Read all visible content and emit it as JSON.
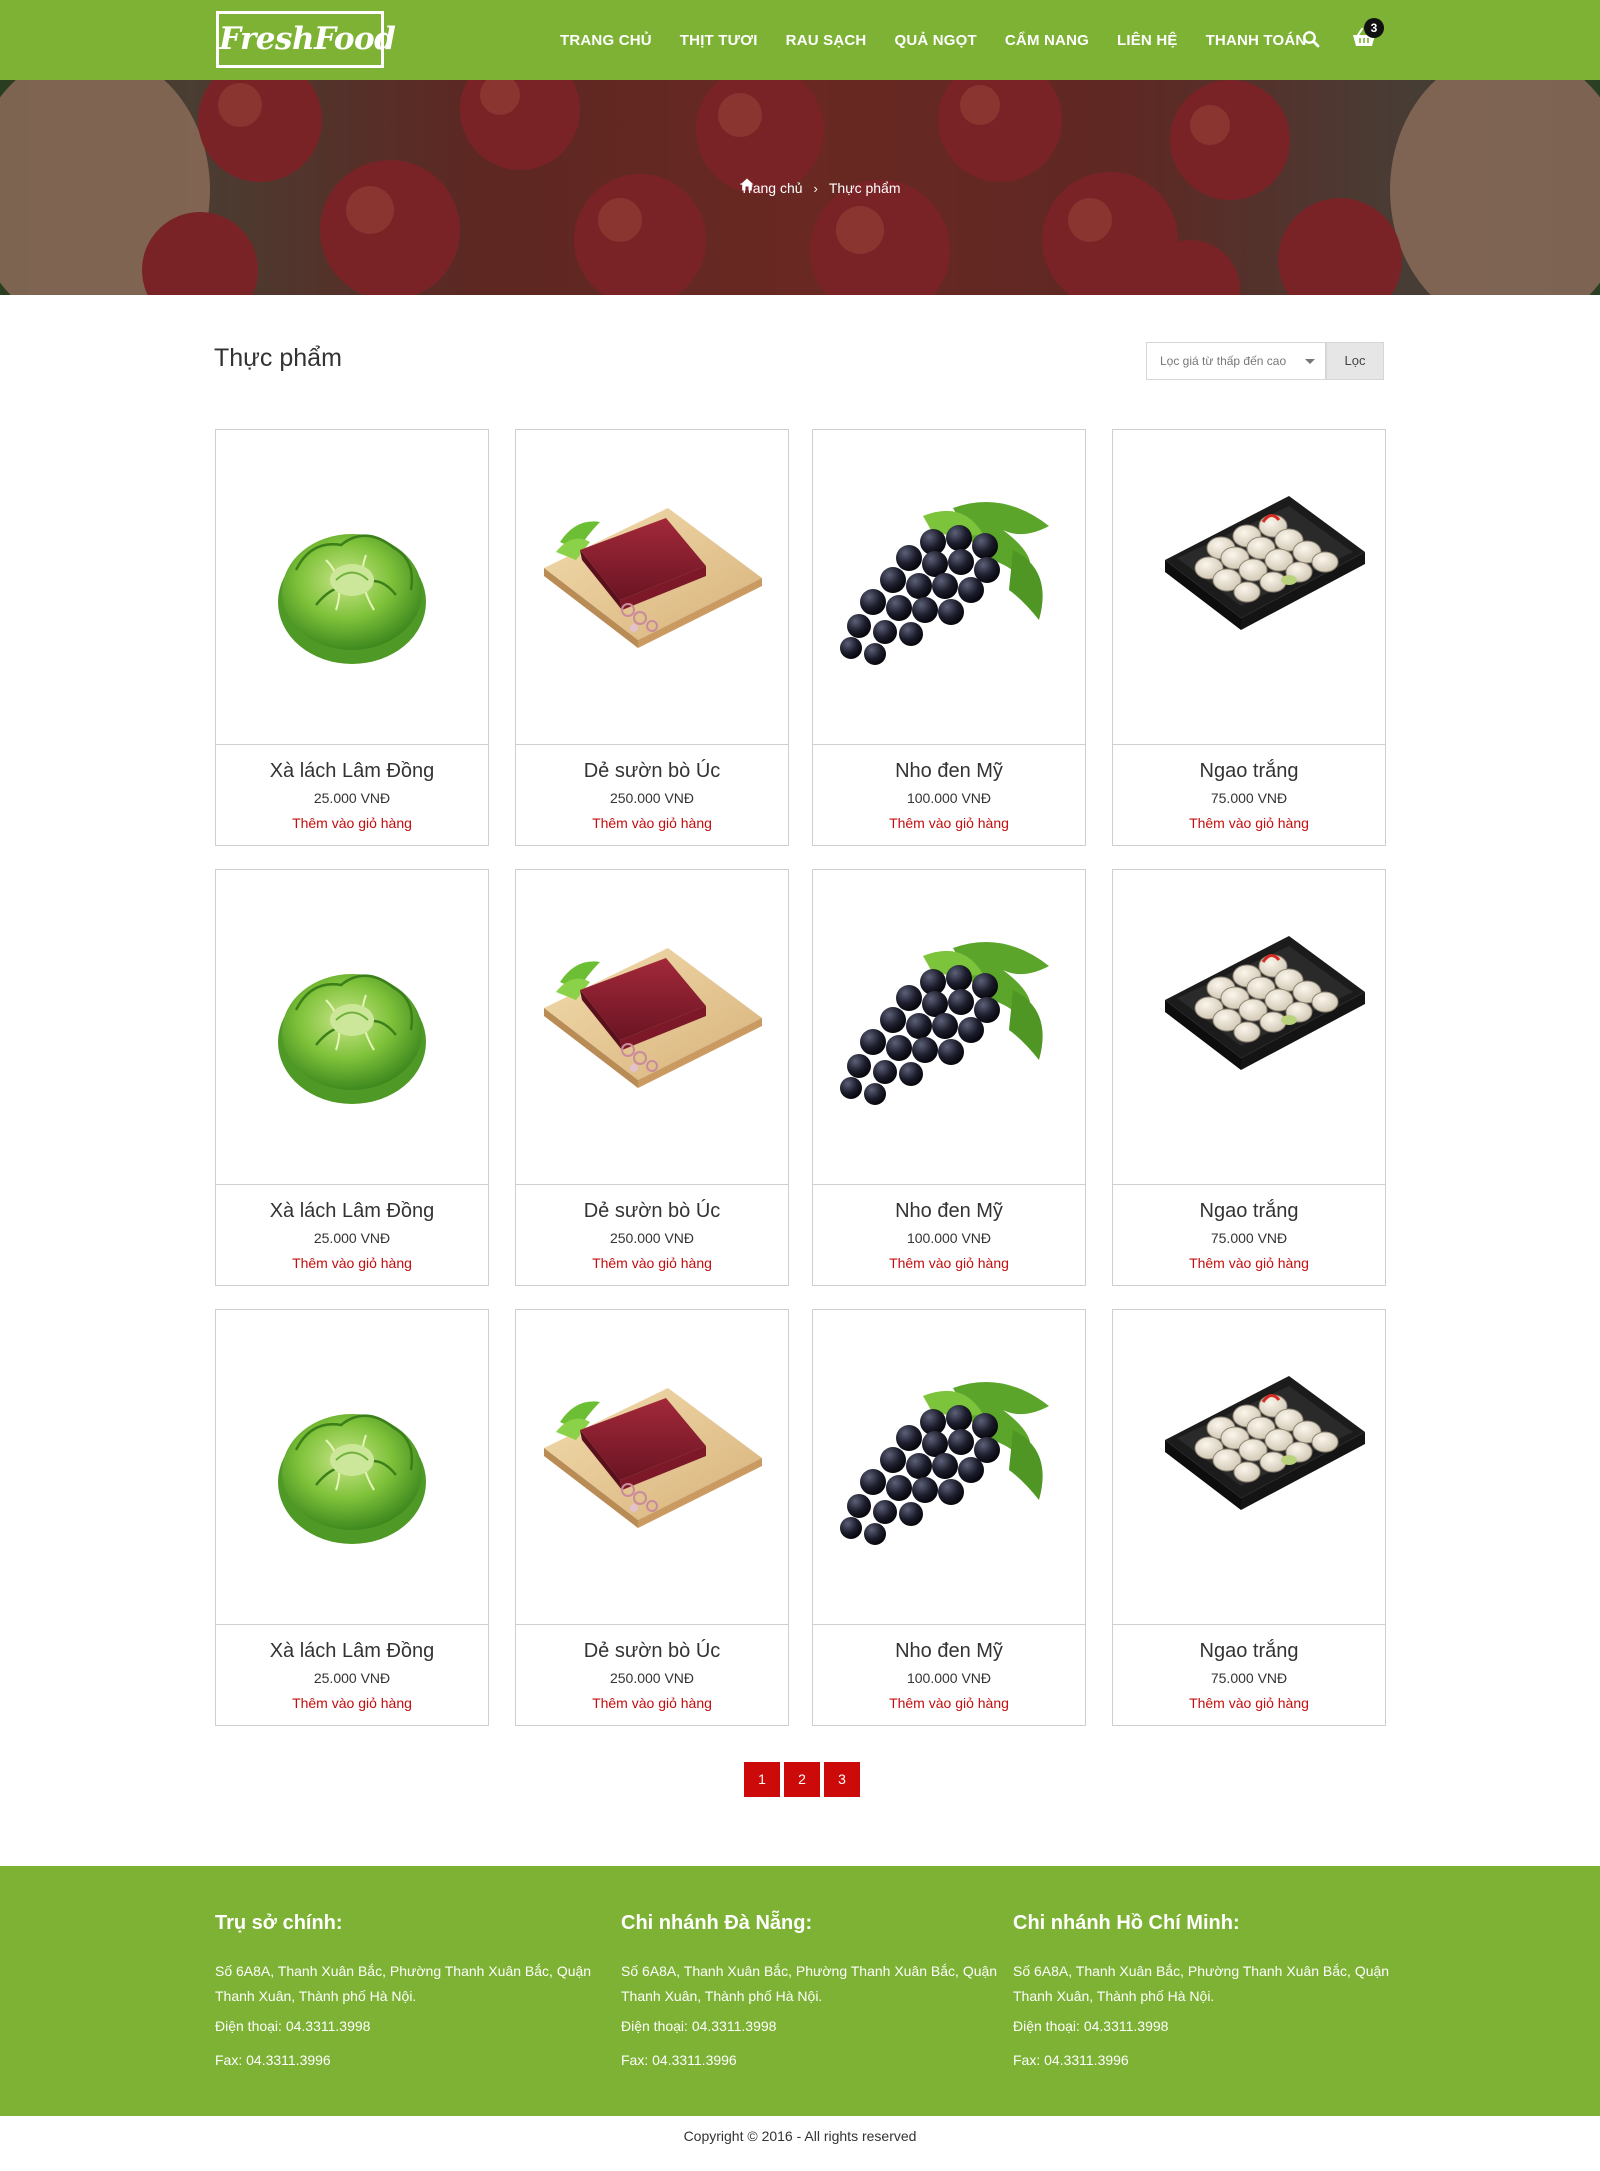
{
  "brand": {
    "logo_text": "FreshFood",
    "color_primary": "#7db234",
    "color_accent": "#cc0a0a"
  },
  "nav": {
    "items": [
      "TRANG CHỦ",
      "THỊT TƯƠI",
      "RAU SẠCH",
      "QUẢ NGỌT",
      "CẨM NANG",
      "LIÊN HỆ",
      "THANH TOÁN"
    ],
    "search_icon": "search-icon",
    "cart_icon": "shopping-basket-icon",
    "cart_count": "3"
  },
  "breadcrumb": {
    "home_icon": "home-icon",
    "home": "Trang chủ",
    "current": "Thực phẩm"
  },
  "page": {
    "title": "Thực phẩm",
    "filter_selected": "Lọc giá từ thấp đến cao",
    "filter_button": "Lọc"
  },
  "products": [
    {
      "name": "Xà lách Lâm Đồng",
      "price": "25.000 VNĐ",
      "add_label": "Thêm vào giỏ hàng",
      "image": "lettuce"
    },
    {
      "name": "Dẻ sườn bò Úc",
      "price": "250.000 VNĐ",
      "add_label": "Thêm vào giỏ hàng",
      "image": "beef"
    },
    {
      "name": "Nho đen Mỹ",
      "price": "100.000 VNĐ",
      "add_label": "Thêm vào giỏ hàng",
      "image": "grapes"
    },
    {
      "name": "Ngao trắng",
      "price": "75.000 VNĐ",
      "add_label": "Thêm vào giỏ hàng",
      "image": "clams"
    },
    {
      "name": "Xà lách Lâm Đồng",
      "price": "25.000 VNĐ",
      "add_label": "Thêm vào giỏ hàng",
      "image": "lettuce"
    },
    {
      "name": "Dẻ sườn bò Úc",
      "price": "250.000 VNĐ",
      "add_label": "Thêm vào giỏ hàng",
      "image": "beef"
    },
    {
      "name": "Nho đen Mỹ",
      "price": "100.000 VNĐ",
      "add_label": "Thêm vào giỏ hàng",
      "image": "grapes"
    },
    {
      "name": "Ngao trắng",
      "price": "75.000 VNĐ",
      "add_label": "Thêm vào giỏ hàng",
      "image": "clams"
    },
    {
      "name": "Xà lách Lâm Đồng",
      "price": "25.000 VNĐ",
      "add_label": "Thêm vào giỏ hàng",
      "image": "lettuce"
    },
    {
      "name": "Dẻ sườn bò Úc",
      "price": "250.000 VNĐ",
      "add_label": "Thêm vào giỏ hàng",
      "image": "beef"
    },
    {
      "name": "Nho đen Mỹ",
      "price": "100.000 VNĐ",
      "add_label": "Thêm vào giỏ hàng",
      "image": "grapes"
    },
    {
      "name": "Ngao trắng",
      "price": "75.000 VNĐ",
      "add_label": "Thêm vào giỏ hàng",
      "image": "clams"
    }
  ],
  "pagination": [
    "1",
    "2",
    "3"
  ],
  "footer": {
    "columns": [
      {
        "title": "Trụ sở chính:",
        "address": "Số 6A8A, Thanh Xuân Bắc, Phường Thanh Xuân Bắc, Quận Thanh Xuân, Thành phố Hà Nội.",
        "phone": "Điện thoại: 04.3311.3998",
        "fax": "Fax: 04.3311.3996"
      },
      {
        "title": "Chi nhánh Đà Nẵng:",
        "address": "Số 6A8A, Thanh Xuân Bắc, Phường Thanh Xuân Bắc, Quận Thanh Xuân, Thành phố Hà Nội.",
        "phone": "Điện thoại: 04.3311.3998",
        "fax": "Fax: 04.3311.3996"
      },
      {
        "title": "Chi nhánh Hồ Chí Minh:",
        "address": "Số 6A8A, Thanh Xuân Bắc, Phường Thanh Xuân Bắc, Quận Thanh Xuân, Thành phố Hà Nội.",
        "phone": "Điện thoại: 04.3311.3998",
        "fax": "Fax: 04.3311.3996"
      }
    ],
    "copyright": "Copyright © 2016 - All rights reserved"
  }
}
